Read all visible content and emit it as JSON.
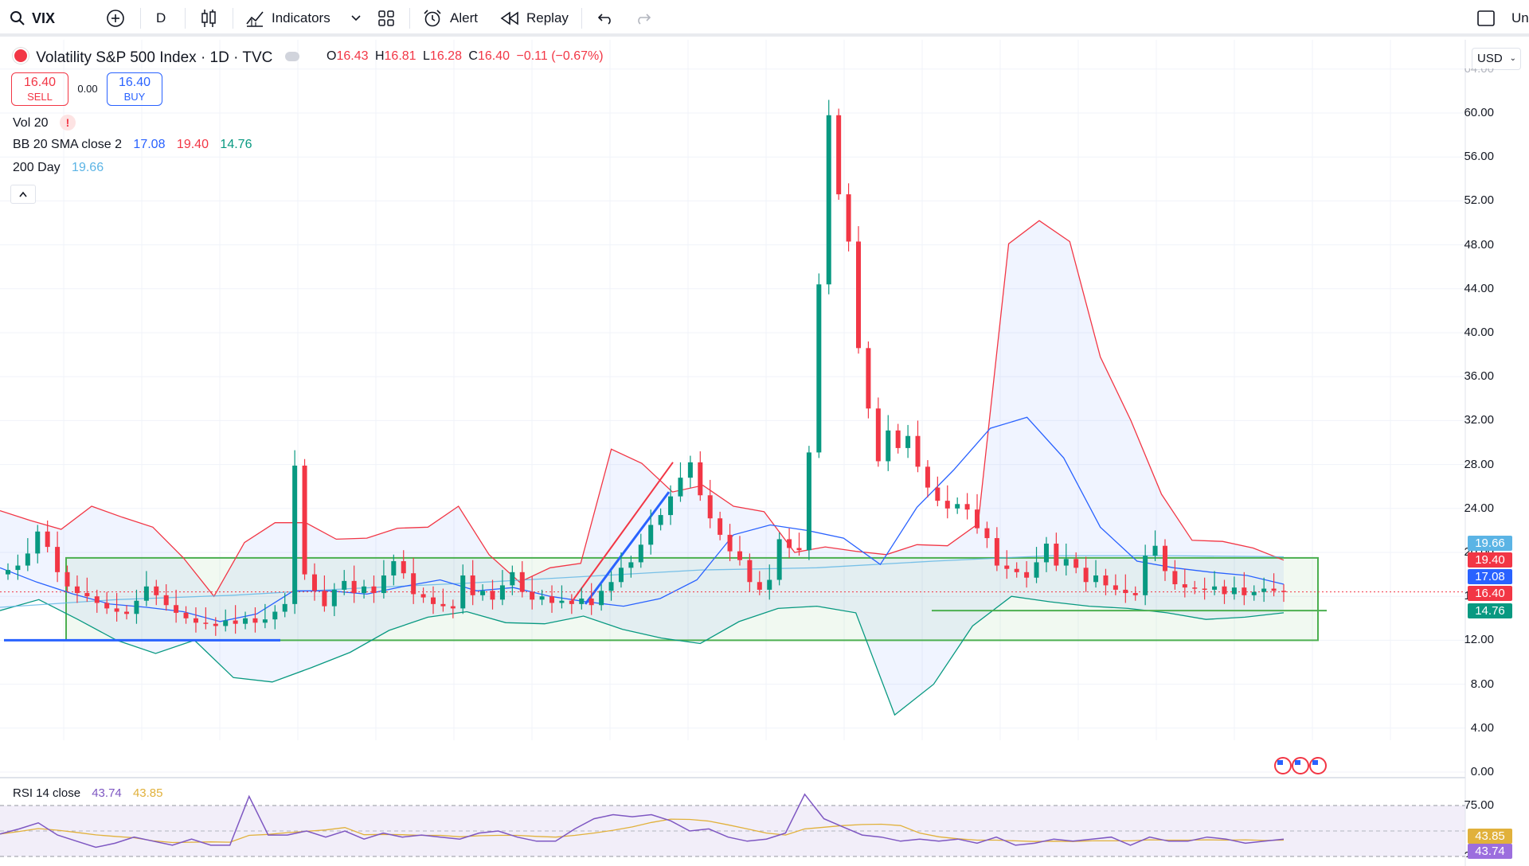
{
  "toolbar": {
    "symbol": "VIX",
    "interval": "D",
    "indicators_label": "Indicators",
    "alert_label": "Alert",
    "replay_label": "Replay",
    "right_text": "Un"
  },
  "legend": {
    "title": "Volatility S&P 500 Index · 1D · TVC",
    "open_label": "O",
    "open": "16.43",
    "high_label": "H",
    "high": "16.81",
    "low_label": "L",
    "low": "16.28",
    "close_label": "C",
    "close": "16.40",
    "change": "−0.11 (−0.67%)",
    "sell_price": "16.40",
    "sell_label": "SELL",
    "spread": "0.00",
    "buy_price": "16.40",
    "buy_label": "BUY"
  },
  "indicators": {
    "vol_label": "Vol 20",
    "vol_warning": "!",
    "bb_label": "BB 20 SMA close 2",
    "bb_mid": "17.08",
    "bb_upper": "19.40",
    "bb_lower": "14.76",
    "ma_label": "200 Day",
    "ma_value": "19.66",
    "rsi_label": "RSI 14 close",
    "rsi_value": "43.74",
    "rsi_ma": "43.85"
  },
  "currency": "USD",
  "price_axis": [
    "64.00",
    "60.00",
    "56.00",
    "52.00",
    "48.00",
    "44.00",
    "40.00",
    "36.00",
    "32.00",
    "28.00",
    "24.00",
    "20.00",
    "16.00",
    "12.00",
    "8.00",
    "4.00",
    "0.00"
  ],
  "rsi_axis": [
    "75.00",
    "25.00"
  ],
  "price_tags": [
    {
      "value": "19.66",
      "color": "#5bb4e5"
    },
    {
      "value": "19.40",
      "color": "#f23645"
    },
    {
      "value": "17.08",
      "color": "#2962ff"
    },
    {
      "value": "16.40",
      "color": "#f23645"
    },
    {
      "value": "14.76",
      "color": "#089981"
    }
  ],
  "rsi_tags": [
    {
      "value": "43.85",
      "color": "#e1b13b"
    },
    {
      "value": "43.74",
      "color": "#9c6ede"
    }
  ],
  "colors": {
    "up": "#089981",
    "down": "#f23645",
    "bb_upper": "#f23645",
    "bb_mid": "#2962ff",
    "bb_lower": "#089981",
    "ma200": "#5bb4e5",
    "rsi": "#7e57c2",
    "rsi_ma": "#e1b13b",
    "rect": "#4caf50"
  },
  "chart_data": {
    "type": "candlestick",
    "title": "Volatility S&P 500 Index · 1D · TVC",
    "ylim": [
      0,
      64
    ],
    "close_path": [
      18.4,
      18.8,
      19.9,
      21.9,
      20.5,
      18.2,
      16.9,
      16.3,
      16.0,
      15.4,
      14.9,
      14.6,
      14.4,
      15.6,
      16.9,
      16.1,
      15.2,
      14.5,
      14.0,
      13.6,
      13.5,
      13.3,
      13.8,
      13.5,
      14.0,
      13.6,
      13.9,
      14.6,
      15.3,
      27.9,
      18.0,
      16.5,
      15.1,
      16.6,
      17.4,
      16.3,
      16.9,
      16.3,
      17.9,
      19.2,
      18.1,
      16.2,
      15.9,
      15.3,
      15.1,
      14.9,
      17.9,
      16.1,
      16.5,
      15.7,
      17.0,
      18.2,
      16.4,
      15.7,
      16.0,
      15.4,
      15.6,
      15.3,
      15.8,
      15.2,
      16.5,
      17.3,
      18.6,
      19.1,
      20.7,
      22.5,
      23.4,
      25.1,
      26.8,
      28.2,
      25.2,
      23.1,
      21.6,
      20.1,
      19.3,
      17.3,
      16.6,
      17.5,
      21.2,
      20.4,
      20.2,
      29.1,
      44.4,
      59.8,
      52.6,
      48.3,
      38.6,
      33.1,
      28.3,
      31.1,
      29.5,
      30.6,
      27.8,
      25.9,
      24.7,
      24.0,
      24.4,
      23.9,
      22.2,
      21.3,
      18.8,
      18.5,
      18.2,
      17.7,
      19.1,
      20.8,
      18.8,
      19.4,
      18.6,
      17.3,
      17.9,
      17.0,
      16.6,
      16.3,
      16.1,
      19.7,
      20.6,
      18.3,
      17.1,
      16.8,
      16.7,
      16.6,
      16.9,
      16.2,
      16.8,
      16.1,
      16.4,
      16.7,
      16.5,
      16.4
    ],
    "bb_upper_path": [
      23.8,
      22.9,
      22.1,
      24.2,
      23.2,
      22.3,
      19.5,
      16.0,
      20.9,
      22.7,
      22.7,
      21.2,
      21.3,
      22.2,
      22.3,
      24.2,
      19.8,
      17.3,
      18.6,
      19.0,
      29.4,
      28.1,
      25.5,
      26.1,
      24.2,
      23.7,
      20.0,
      20.5,
      20.1,
      19.8,
      20.7,
      20.6,
      22.6,
      48.1,
      50.2,
      48.3,
      37.8,
      32.0,
      25.3,
      21.1,
      21.0,
      20.4,
      19.3
    ],
    "bb_mid_path": [
      18.6,
      17.3,
      16.2,
      15.3,
      15.0,
      14.6,
      13.7,
      14.4,
      16.5,
      16.5,
      16.2,
      16.9,
      17.5,
      16.5,
      16.8,
      16.0,
      15.5,
      15.1,
      15.8,
      17.5,
      21.6,
      22.5,
      22.0,
      21.3,
      18.9,
      24.1,
      27.5,
      31.3,
      32.3,
      28.6,
      22.3,
      19.2,
      18.6,
      18.2,
      17.9,
      17.1
    ],
    "bb_lower_path": [
      14.7,
      15.7,
      13.9,
      12.0,
      10.8,
      12.0,
      8.6,
      8.2,
      9.5,
      10.9,
      12.9,
      14.1,
      14.6,
      13.6,
      13.5,
      14.2,
      13.0,
      12.2,
      11.7,
      13.7,
      14.9,
      15.1,
      14.5,
      5.2,
      8.0,
      13.3,
      16.0,
      15.5,
      15.1,
      14.9,
      14.5,
      13.9,
      14.1,
      14.5
    ],
    "ma200_path": [
      15.0,
      15.7,
      16.1,
      16.7,
      17.2,
      17.8,
      18.4,
      18.6,
      19.2,
      19.7,
      19.7,
      19.6
    ],
    "rsi_path": [
      47,
      52,
      58,
      46,
      40,
      34,
      38,
      44,
      40,
      36,
      42,
      36,
      36,
      84,
      46,
      46,
      50,
      44,
      50,
      42,
      48,
      44,
      46,
      44,
      42,
      48,
      50,
      44,
      40,
      40,
      52,
      62,
      66,
      64,
      66,
      60,
      50,
      52,
      44,
      40,
      42,
      48,
      86,
      62,
      54,
      46,
      44,
      40,
      42,
      40,
      42,
      38,
      44,
      36,
      38,
      42,
      40,
      42,
      44,
      36,
      44,
      40,
      40,
      44,
      42,
      38,
      40,
      42
    ]
  }
}
